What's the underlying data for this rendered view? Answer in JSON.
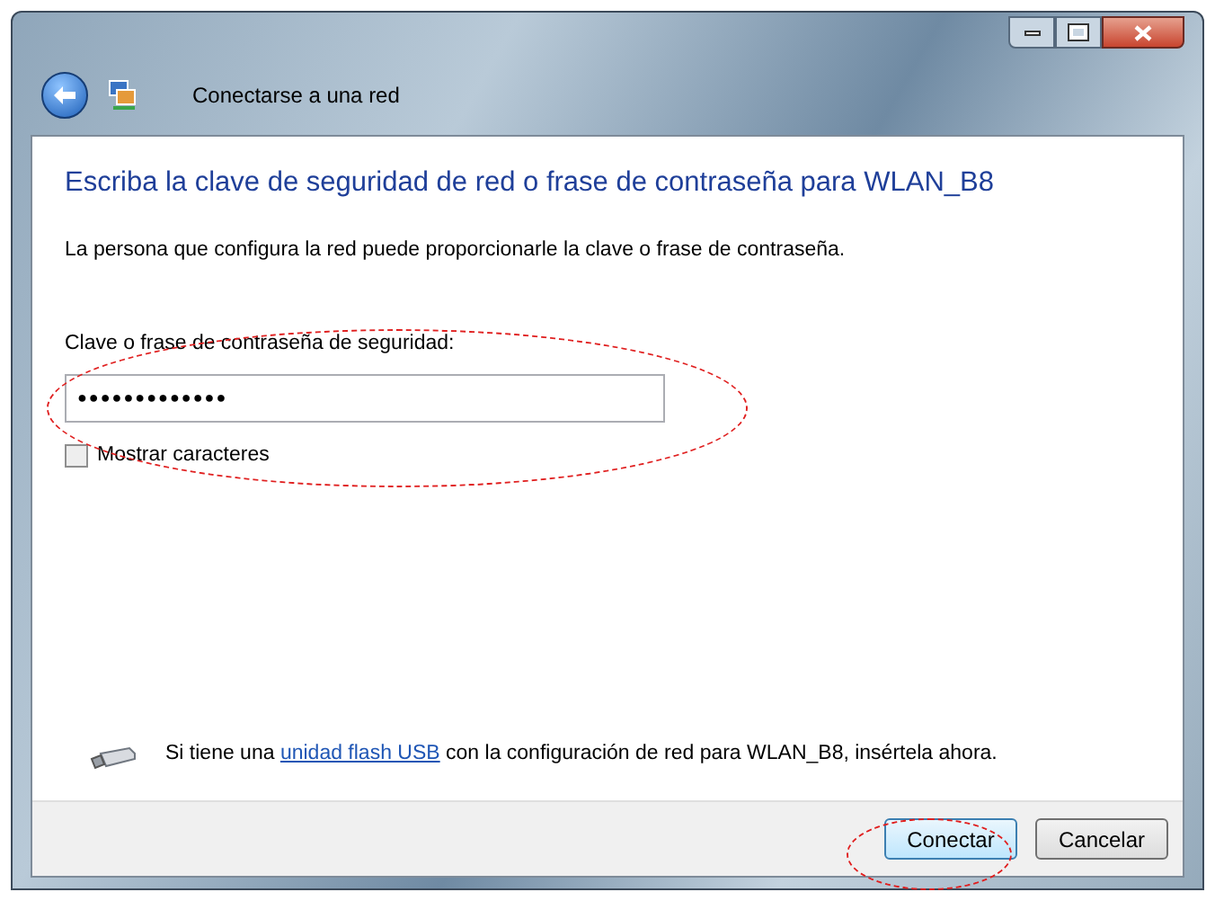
{
  "window": {
    "title": "Conectarse a una red"
  },
  "heading": "Escriba la clave de seguridad de red o frase de contraseña para WLAN_B8",
  "description": "La persona que configura la red puede proporcionarle la clave o frase de contraseña.",
  "password": {
    "label": "Clave o frase de contraseña de seguridad:",
    "value": "●●●●●●●●●●●●●"
  },
  "show_characters": {
    "label": "Mostrar caracteres",
    "checked": false
  },
  "usb_hint": {
    "before": "Si tiene una",
    "link": "unidad flash USB",
    "after": "con la configuración de red para WLAN_B8, insértela ahora."
  },
  "buttons": [
    {
      "label": "Conectar",
      "default": true
    },
    {
      "label": "Cancelar",
      "default": false
    }
  ]
}
